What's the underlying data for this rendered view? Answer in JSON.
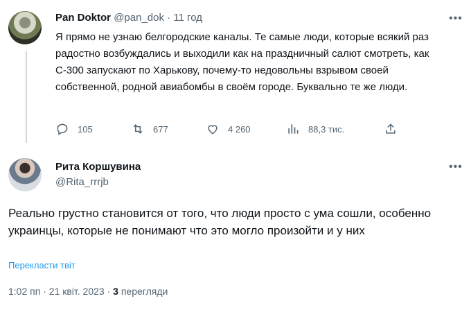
{
  "tweet1": {
    "author_name": "Pan Doktor",
    "handle": "@pan_dok",
    "separator": "·",
    "time": "11 год",
    "text": "Я прямо не узнаю белгородские каналы. Те самые люди, которые всякий раз радостно возбуждались и выходили как на праздничный салют смотреть, как С-300 запускают по Харькову, почему-то недовольны взрывом своей собственной, родной авиабомбы в своём городе. Буквально те же люди.",
    "more": "•••",
    "replies": "105",
    "retweets": "677",
    "likes": "4 260",
    "views": "88,3 тис."
  },
  "tweet2": {
    "author_name": "Рита Коршувина",
    "handle": "@Rita_rrrjb",
    "more": "•••",
    "text": "Реально грустно становится от того, что люди просто с ума сошли, особенно украинцы, которые не понимают что это могло произойти и у них",
    "translate_label": "Перекласти твіт",
    "time": "1:02 пп",
    "date": "21 квіт. 2023",
    "dot": "·",
    "views_count": "3",
    "views_label": "перегляди"
  },
  "icons": {
    "reply": "reply-icon",
    "retweet": "retweet-icon",
    "like": "heart-icon",
    "views": "views-icon",
    "share": "share-icon"
  },
  "colors": {
    "link": "#1d9bf0",
    "muted": "#536471",
    "text": "#0f1419",
    "thread_line": "#cfd9de"
  }
}
